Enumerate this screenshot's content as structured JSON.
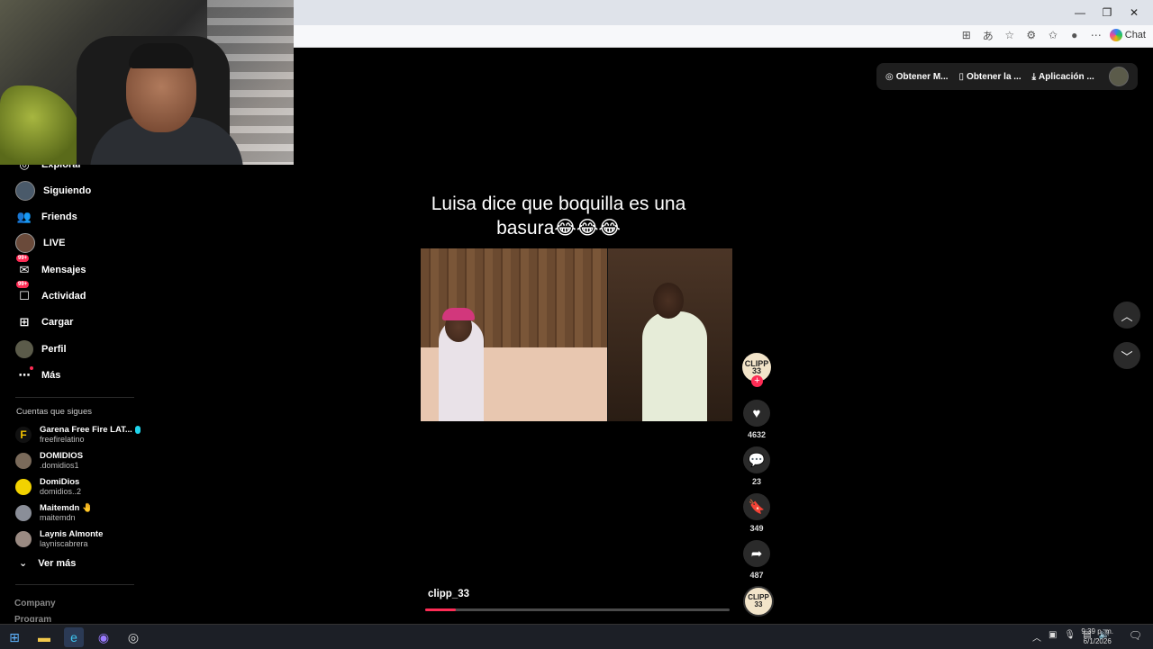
{
  "browser": {
    "window_controls": {
      "minimize": "—",
      "maximize": "❐",
      "close": "✕"
    },
    "toolbar": {
      "chat_label": "Chat"
    }
  },
  "sidebar": {
    "items": [
      {
        "label": "Explorar",
        "icon": "compass-icon"
      },
      {
        "label": "Siguiendo",
        "icon": "following-avatar"
      },
      {
        "label": "Friends",
        "icon": "friends-icon"
      },
      {
        "label": "LIVE",
        "icon": "live-avatar"
      },
      {
        "label": "Mensajes",
        "icon": "messages-icon",
        "badge": "99+"
      },
      {
        "label": "Actividad",
        "icon": "activity-icon",
        "badge": "99+"
      },
      {
        "label": "Cargar",
        "icon": "upload-icon"
      },
      {
        "label": "Perfil",
        "icon": "profile-avatar"
      },
      {
        "label": "Más",
        "icon": "more-icon"
      }
    ],
    "following_title": "Cuentas que sigues",
    "following": [
      {
        "name": "Garena Free Fire LAT...",
        "handle": "freefirelatino"
      },
      {
        "name": "DOMIDIOS",
        "handle": ".domidios1"
      },
      {
        "name": "DomiDios",
        "handle": "domidios..2"
      },
      {
        "name": "Maitemdn",
        "handle": "maitemdn"
      },
      {
        "name": "Laynis Almonte",
        "handle": "layniscabrera"
      }
    ],
    "see_more": "Ver más",
    "footer": [
      "Company",
      "Program"
    ]
  },
  "top_actions": [
    "Obtener M...",
    "Obtener la ...",
    "Aplicación ..."
  ],
  "video": {
    "caption": "Luisa dice que boquilla es una basura😂😂😂",
    "author": "clipp_33",
    "creator_avatar_text": "CLIPP 33",
    "progress": 0.1,
    "likes": "4632",
    "comments": "23",
    "saves": "349",
    "shares": "487"
  },
  "taskbar": {
    "time": "9:39 p. m.",
    "date": "6/1/2026"
  },
  "colors": {
    "accent": "#fe2c55",
    "background": "#000000"
  }
}
